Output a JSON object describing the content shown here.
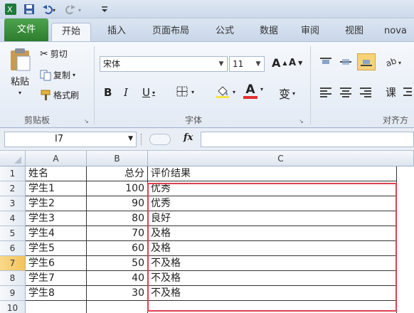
{
  "tabs": {
    "file": "文件",
    "home": "开始",
    "insert": "插入",
    "page_layout": "页面布局",
    "formulas": "公式",
    "data": "数据",
    "review": "审阅",
    "view": "视图",
    "extra": "nova"
  },
  "clipboard": {
    "paste": "粘贴",
    "cut": "剪切",
    "copy": "复制",
    "format_painter": "格式刷",
    "group_label": "剪贴板"
  },
  "font": {
    "name": "宋体",
    "size": "11",
    "grow": "A",
    "shrink": "A",
    "bold": "B",
    "italic": "I",
    "underline": "U",
    "font_color_letter": "A",
    "phonetic": "变",
    "group_label": "字体"
  },
  "alignment": {
    "wrap": "课",
    "group_label": "对齐方"
  },
  "formula_bar": {
    "cell_ref": "I7",
    "fx": "fx",
    "value": ""
  },
  "colors": {
    "accent_file_tab": "#2c7d2c",
    "selection_border": "#e0404e",
    "font_color_bar": "#e03030"
  },
  "sheet": {
    "columns": [
      "A",
      "B",
      "C"
    ],
    "rows": [
      {
        "num": "1",
        "a": "姓名",
        "b": "总分",
        "c": "评价结果"
      },
      {
        "num": "2",
        "a": "学生1",
        "b": "100",
        "c": "优秀"
      },
      {
        "num": "3",
        "a": "学生2",
        "b": "90",
        "c": "优秀"
      },
      {
        "num": "4",
        "a": "学生3",
        "b": "80",
        "c": "良好"
      },
      {
        "num": "5",
        "a": "学生4",
        "b": "70",
        "c": "及格"
      },
      {
        "num": "6",
        "a": "学生5",
        "b": "60",
        "c": "及格"
      },
      {
        "num": "7",
        "a": "学生6",
        "b": "50",
        "c": "不及格"
      },
      {
        "num": "8",
        "a": "学生7",
        "b": "40",
        "c": "不及格"
      },
      {
        "num": "9",
        "a": "学生8",
        "b": "30",
        "c": "不及格"
      },
      {
        "num": "10",
        "a": "",
        "b": "",
        "c": ""
      }
    ]
  }
}
